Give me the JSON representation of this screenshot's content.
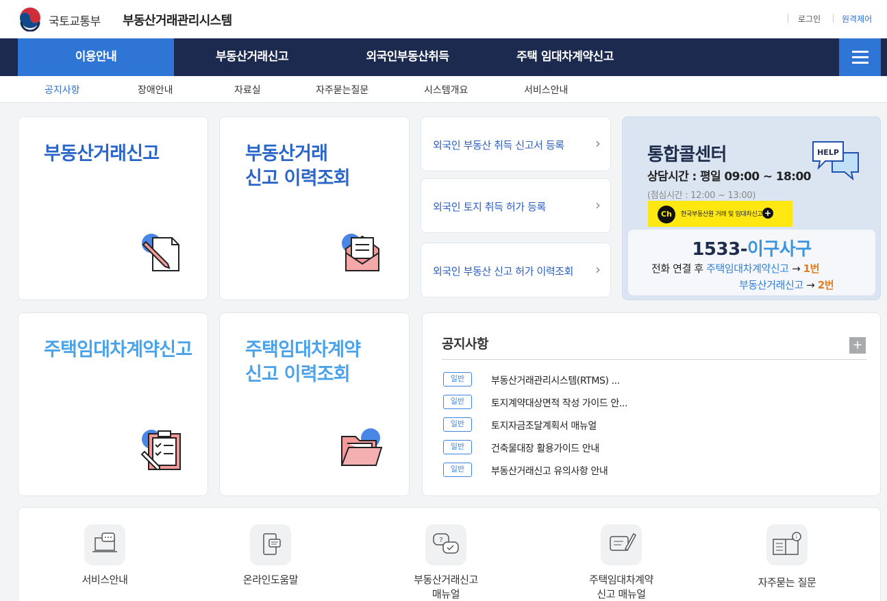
{
  "header": {
    "ministry": "국토교통부",
    "system_name": "부동산거래관리시스템",
    "login": "로그인",
    "remote_control": "원격제어"
  },
  "nav": {
    "items": [
      {
        "label": "이용안내"
      },
      {
        "label": "부동산거래신고"
      },
      {
        "label": "외국인부동산취득"
      },
      {
        "label": "주택 임대차계약신고"
      }
    ]
  },
  "subnav": {
    "items": [
      {
        "label": "공지사항"
      },
      {
        "label": "장애안내"
      },
      {
        "label": "자료실"
      },
      {
        "label": "자주묻는질문"
      },
      {
        "label": "시스템개요"
      },
      {
        "label": "서비스안내"
      }
    ]
  },
  "cards": {
    "report": {
      "title": "부동산거래신고"
    },
    "history": {
      "line1": "부동산거래",
      "line2": "신고 이력조회"
    },
    "lease": {
      "title": "주택임대차계약신고"
    },
    "lease_history": {
      "line1": "주택임대차계약",
      "line2": "신고 이력조회"
    }
  },
  "foreign_links": [
    {
      "label": "외국인 부동산 취득 신고서 등록"
    },
    {
      "label": "외국인 토지 취득 허가 등록"
    },
    {
      "label": "외국인 부동산 신고 허가 이력조회"
    }
  ],
  "call_center": {
    "title": "통합콜센터",
    "hours": "상담시간 : 평일 09:00 ~ 18:00",
    "lunch": "(점심시간 : 12:00 ~ 13:00)",
    "help_label": "HELP",
    "kakao_ch": "Ch",
    "kakao_text": "한국부동산원 거래 및 임대차신고",
    "number_prefix": "1533-",
    "number_word": "이구사구",
    "line1_prefix": "전화 연결 후 ",
    "line1_service": "주택임대차계약신고",
    "line1_arrow": " → ",
    "line1_key": "1번",
    "line2_service": "부동산거래신고",
    "line2_arrow": " → ",
    "line2_key": "2번"
  },
  "notice": {
    "title": "공지사항",
    "more": "+",
    "items": [
      {
        "badge": "일반",
        "text": "부동산거래관리시스템(RTMS) ..."
      },
      {
        "badge": "일반",
        "text": "토지계약대상면적 작성 가이드 안..."
      },
      {
        "badge": "일반",
        "text": "토지자금조달계획서 매뉴얼"
      },
      {
        "badge": "일반",
        "text": "건축물대장 활용가이드 안내"
      },
      {
        "badge": "일반",
        "text": "부동산거래신고 유의사항 안내"
      }
    ]
  },
  "quick_links": [
    {
      "label": "서비스안내",
      "icon": "laptop-chat-icon"
    },
    {
      "label": "온라인도움말",
      "icon": "mobile-chat-icon"
    },
    {
      "label": "부동산거래신고 매뉴얼",
      "line1": "부동산거래신고",
      "line2": "매뉴얼",
      "icon": "question-chat-icon"
    },
    {
      "label": "주택임대차계약 신고 매뉴얼",
      "line1": "주택임대차계약",
      "line2": "신고 매뉴얼",
      "icon": "pen-note-icon"
    },
    {
      "label": "자주묻는 질문",
      "icon": "book-info-icon"
    }
  ],
  "colors": {
    "nav_bg": "#1b2a4e",
    "accent_blue": "#2f75d6",
    "title_blue": "#2a66c9",
    "light_blue": "#4aa3ea",
    "orange": "#e27a1f",
    "kakao_yellow": "#ffe812"
  }
}
